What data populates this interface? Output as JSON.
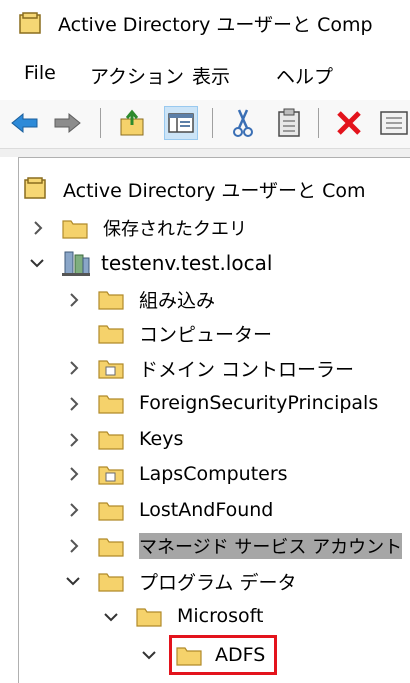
{
  "window": {
    "title": "Active Directory ユーザーと Comp"
  },
  "menu": {
    "items": [
      "File",
      "アクション",
      "表示",
      "ヘルプ"
    ]
  },
  "toolbar": {
    "buttons": [
      "back-icon",
      "forward-icon",
      "up-folder-icon",
      "show-tree-icon",
      "cut-icon",
      "paste-icon",
      "delete-icon",
      "properties-icon"
    ]
  },
  "tree": {
    "root": "Active Directory ユーザーと Com",
    "saved_queries": "保存されたクエリ",
    "domain": "testenv.test.local",
    "children": [
      "組み込み",
      "コンピューター",
      "ドメイン コントローラー",
      "ForeignSecurityPrincipals",
      "Keys",
      "LapsComputers",
      "LostAndFound",
      "マネージド サービス アカウント",
      "プログラム データ"
    ],
    "microsoft": "Microsoft",
    "adfs": "ADFS"
  },
  "colors": {
    "highlight_box": "#e3131c",
    "selected_row": "#a6a6a6",
    "folder": "#f5d26b"
  }
}
